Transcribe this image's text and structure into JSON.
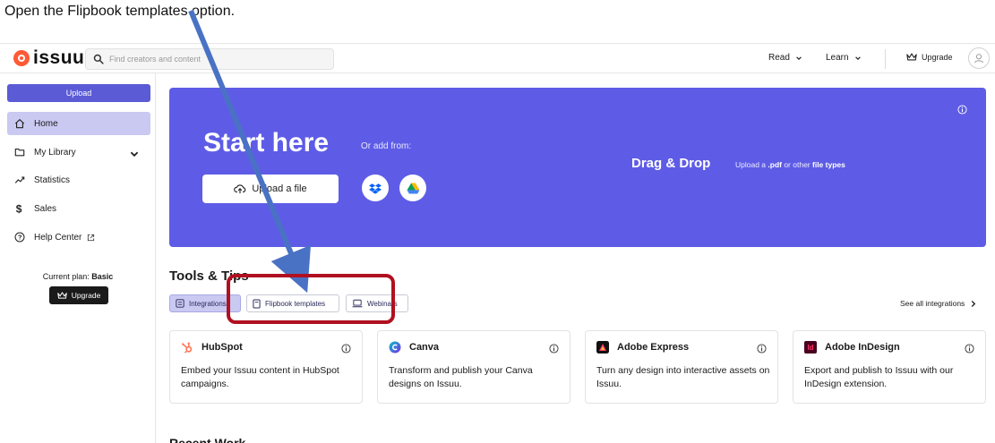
{
  "instruction_text": "Open the Flipbook templates option.",
  "header": {
    "logo_text": "issuu",
    "search_placeholder": "Find creators and content",
    "nav": [
      {
        "label": "Read"
      },
      {
        "label": "Learn"
      }
    ],
    "upgrade_label": "Upgrade"
  },
  "sidebar": {
    "upload_label": "Upload",
    "items": [
      {
        "label": "Home",
        "icon": "home-icon"
      },
      {
        "label": "My Library",
        "icon": "library-icon"
      },
      {
        "label": "Statistics",
        "icon": "statistics-icon"
      },
      {
        "label": "Sales",
        "icon": "dollar-icon"
      },
      {
        "label": "Help Center",
        "icon": "help-icon"
      }
    ],
    "plan_prefix": "Current plan: ",
    "plan_name": "Basic",
    "upgrade_label": "Upgrade"
  },
  "hero": {
    "title": "Start here",
    "or_add_from": "Or add from:",
    "upload_file_label": "Upload a file",
    "drag_drop_title": "Drag & Drop",
    "drag_sub_prefix": "Upload a ",
    "drag_sub_pdf": ".pdf",
    "drag_sub_mid": " or other ",
    "drag_sub_types": "file types"
  },
  "tools": {
    "title": "Tools & Tips",
    "chips": [
      {
        "label": "Integrations"
      },
      {
        "label": "Flipbook templates"
      },
      {
        "label": "Webinars"
      }
    ],
    "see_all_label": "See all integrations",
    "cards": [
      {
        "name": "HubSpot",
        "desc": "Embed your Issuu content in HubSpot campaigns."
      },
      {
        "name": "Canva",
        "desc": "Transform and publish your Canva designs on Issuu."
      },
      {
        "name": "Adobe Express",
        "desc": "Turn any design into interactive assets on Issuu."
      },
      {
        "name": "Adobe InDesign",
        "desc": "Export and publish to Issuu with our InDesign extension.",
        "logo_text": "Id"
      }
    ]
  },
  "recent_work_title": "Recent Work",
  "colors": {
    "brand": "#5e5ce6",
    "active_nav": "#c9c9f2",
    "annotation_arrow": "#4a72c4",
    "annotation_box": "#b01020"
  }
}
